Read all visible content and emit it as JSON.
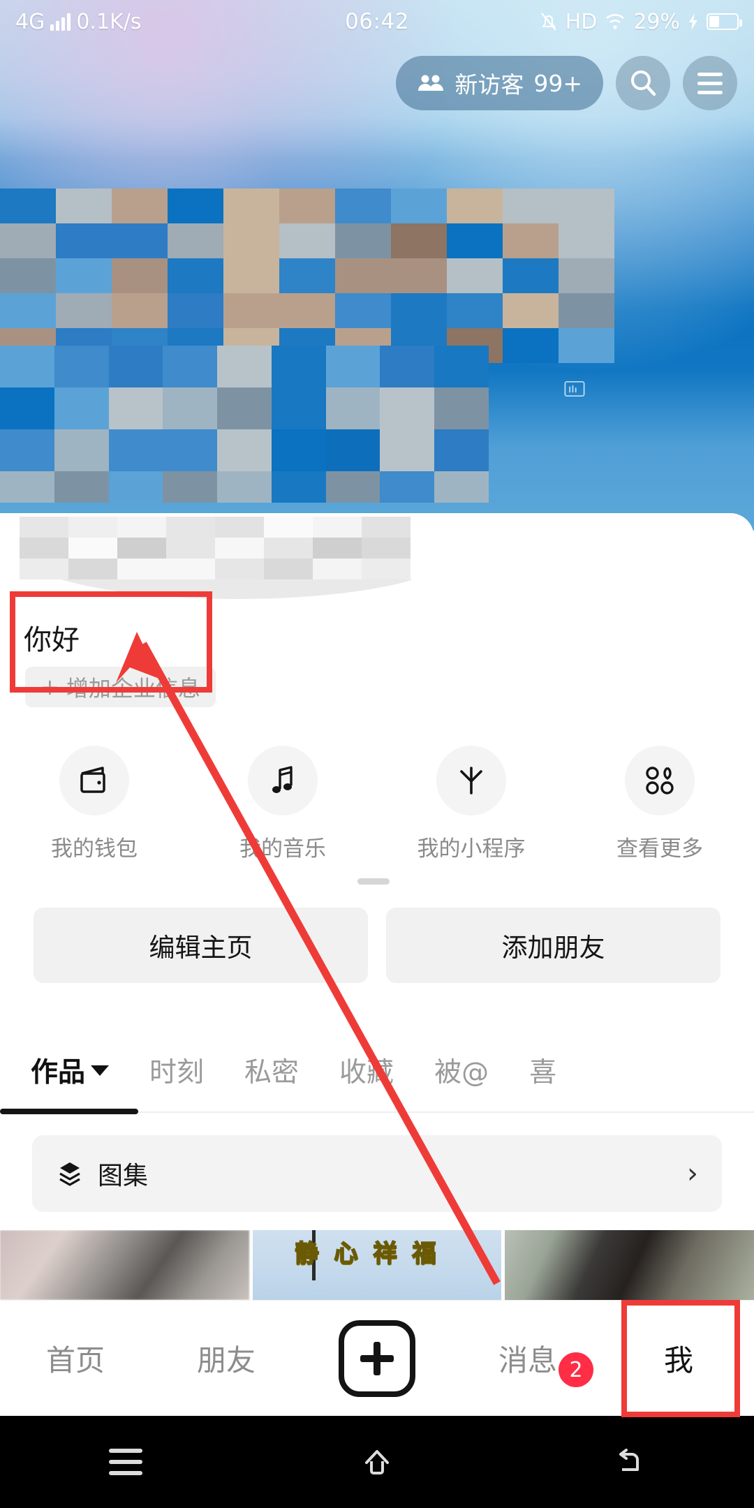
{
  "status_bar": {
    "network_type": "4G",
    "data_rate": "0.1K/s",
    "time": "06:42",
    "hd_label": "HD",
    "battery_percent": "29%",
    "icons": [
      "signal-bars-icon",
      "bell-muted-icon",
      "hd-icon",
      "wifi-icon",
      "charging-bolt-icon",
      "battery-icon"
    ]
  },
  "header": {
    "visitor_label": "新访客",
    "visitor_count": "99+",
    "people_icon": "people-icon",
    "search_icon": "search-icon",
    "menu_icon": "hamburger-menu-icon"
  },
  "profile": {
    "username_masked": "",
    "greeting": "你好",
    "business_info_button": "+ 增加企业信息",
    "business_info_plus": "+",
    "business_info_label": "增加企业信息"
  },
  "quick_actions": [
    {
      "label": "我的钱包",
      "icon": "wallet-icon"
    },
    {
      "label": "我的音乐",
      "icon": "music-note-icon"
    },
    {
      "label": "我的小程序",
      "icon": "mini-program-asterisk-icon"
    },
    {
      "label": "查看更多",
      "icon": "grid-more-icon"
    }
  ],
  "actions": {
    "edit_home": "编辑主页",
    "add_friend": "添加朋友"
  },
  "tabs": [
    {
      "label": "作品",
      "active": true,
      "has_caret": true
    },
    {
      "label": "时刻",
      "active": false
    },
    {
      "label": "私密",
      "active": false
    },
    {
      "label": "收藏",
      "active": false
    },
    {
      "label": "被@",
      "active": false
    },
    {
      "label": "喜",
      "active": false
    }
  ],
  "album_row": {
    "label": "图集",
    "icon": "layers-icon",
    "chevron": "›"
  },
  "video_grid": {
    "thumb_2_text": [
      "静",
      "心",
      "祥",
      "福"
    ]
  },
  "bottom_nav": [
    {
      "label": "首页",
      "active": false
    },
    {
      "label": "朋友",
      "active": false
    },
    {
      "label": "",
      "active": false,
      "icon": "plus-create-icon"
    },
    {
      "label": "消息",
      "active": false,
      "badge": "2"
    },
    {
      "label": "我",
      "active": true
    }
  ],
  "android_nav": [
    {
      "icon": "recents-menu-icon"
    },
    {
      "icon": "home-icon"
    },
    {
      "icon": "back-icon"
    }
  ],
  "annotations": {
    "highlight_color": "#ef3b37",
    "boxes": [
      "greeting-area",
      "me-tab"
    ],
    "arrow": "points from 我 tab up-left to greeting area"
  },
  "colors": {
    "accent_red": "#ef3b37",
    "badge_red": "#ff2d45",
    "banner_blue": "#0a72c0",
    "text_dark": "#141414",
    "text_muted": "#8c8c8c"
  }
}
